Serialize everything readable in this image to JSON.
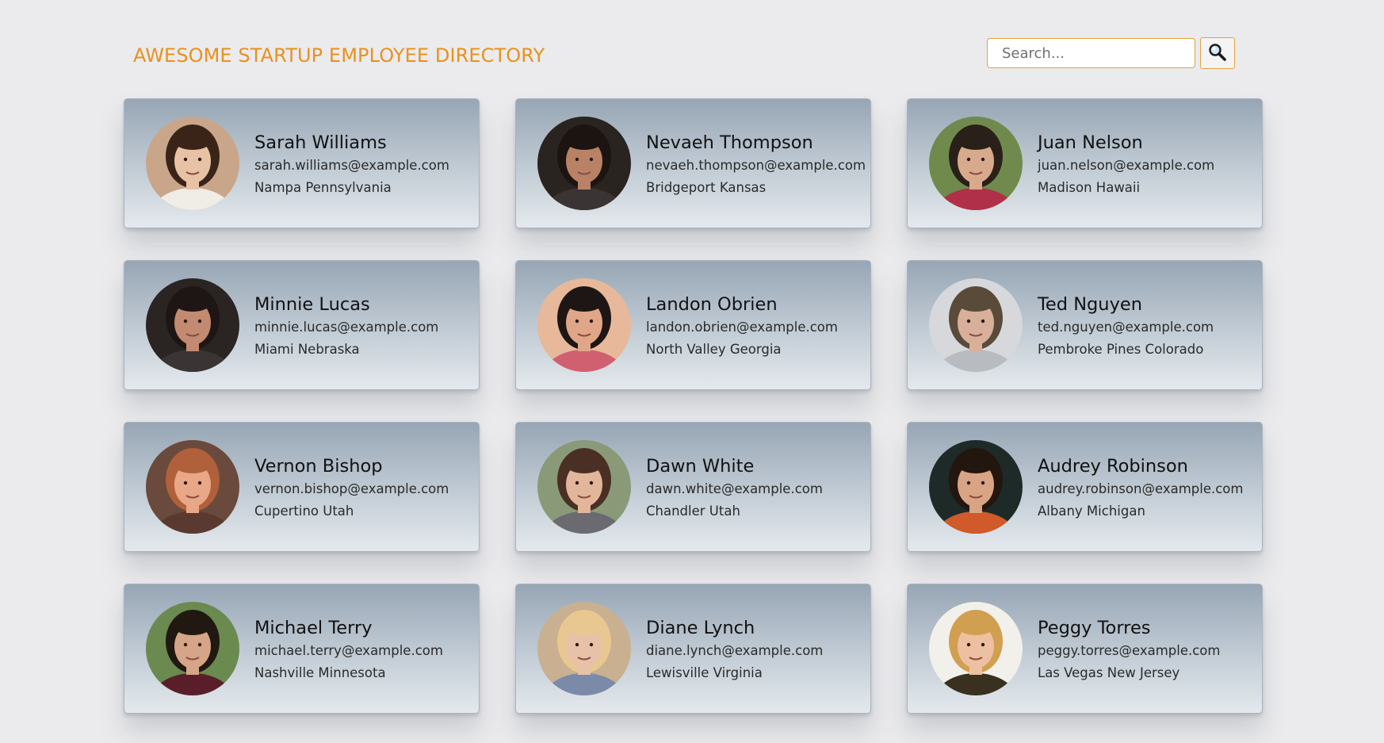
{
  "header": {
    "title": "AWESOME STARTUP EMPLOYEE DIRECTORY"
  },
  "search": {
    "placeholder": "Search...",
    "value": "",
    "button_icon": "magnifier-icon"
  },
  "colors": {
    "accent": "#e8911e",
    "page_background": "#ebebed",
    "card_gradient_top": "#97a6b5",
    "card_gradient_bottom": "#e4e9ed"
  },
  "employees": [
    {
      "name": "Sarah Williams",
      "email": "sarah.williams@example.com",
      "location": "Nampa Pennsylvania",
      "photo": {
        "bg": "#c9a68a",
        "skin": "#e7c2a4",
        "hair": "#3a2418",
        "shirt": "#f0ece6"
      }
    },
    {
      "name": "Nevaeh Thompson",
      "email": "nevaeh.thompson@example.com",
      "location": "Bridgeport Kansas",
      "photo": {
        "bg": "#2a2420",
        "skin": "#b98266",
        "hair": "#1c1410",
        "shirt": "#3a3434"
      }
    },
    {
      "name": "Juan Nelson",
      "email": "juan.nelson@example.com",
      "location": "Madison Hawaii",
      "photo": {
        "bg": "#6f8a4c",
        "skin": "#d8aa8c",
        "hair": "#2a201a",
        "shirt": "#b0304a"
      }
    },
    {
      "name": "Minnie Lucas",
      "email": "minnie.lucas@example.com",
      "location": "Miami Nebraska",
      "photo": {
        "bg": "#2a2422",
        "skin": "#c28a70",
        "hair": "#1e1614",
        "shirt": "#3a3434"
      }
    },
    {
      "name": "Landon Obrien",
      "email": "landon.obrien@example.com",
      "location": "North Valley Georgia",
      "photo": {
        "bg": "#e8b89a",
        "skin": "#e0a688",
        "hair": "#1e1614",
        "shirt": "#d06070"
      }
    },
    {
      "name": "Ted Nguyen",
      "email": "ted.nguyen@example.com",
      "location": "Pembroke Pines Colorado",
      "photo": {
        "bg": "#d6d8dc",
        "skin": "#d8b09a",
        "hair": "#5a4a3a",
        "shirt": "#b8bcc0"
      }
    },
    {
      "name": "Vernon Bishop",
      "email": "vernon.bishop@example.com",
      "location": "Cupertino Utah",
      "photo": {
        "bg": "#6a4a3c",
        "skin": "#e8a888",
        "hair": "#b0603a",
        "shirt": "#5a3a30"
      }
    },
    {
      "name": "Dawn White",
      "email": "dawn.white@example.com",
      "location": "Chandler Utah",
      "photo": {
        "bg": "#8a9a78",
        "skin": "#e2b69a",
        "hair": "#4a3024",
        "shirt": "#6a6a70"
      }
    },
    {
      "name": "Audrey Robinson",
      "email": "audrey.robinson@example.com",
      "location": "Albany Michigan",
      "photo": {
        "bg": "#1e2a28",
        "skin": "#d8a484",
        "hair": "#22160e",
        "shirt": "#d05a2a"
      }
    },
    {
      "name": "Michael Terry",
      "email": "michael.terry@example.com",
      "location": "Nashville Minnesota",
      "photo": {
        "bg": "#6a8a50",
        "skin": "#d6a486",
        "hair": "#221812",
        "shirt": "#5a1e2a"
      }
    },
    {
      "name": "Diane Lynch",
      "email": "diane.lynch@example.com",
      "location": "Lewisville Virginia",
      "photo": {
        "bg": "#c8b090",
        "skin": "#e8c2a8",
        "hair": "#e8c890",
        "shirt": "#7a8aa8"
      }
    },
    {
      "name": "Peggy Torres",
      "email": "peggy.torres@example.com",
      "location": "Las Vegas New Jersey",
      "photo": {
        "bg": "#f2f0ea",
        "skin": "#ecc0a0",
        "hair": "#d0a050",
        "shirt": "#3a3020"
      }
    }
  ]
}
